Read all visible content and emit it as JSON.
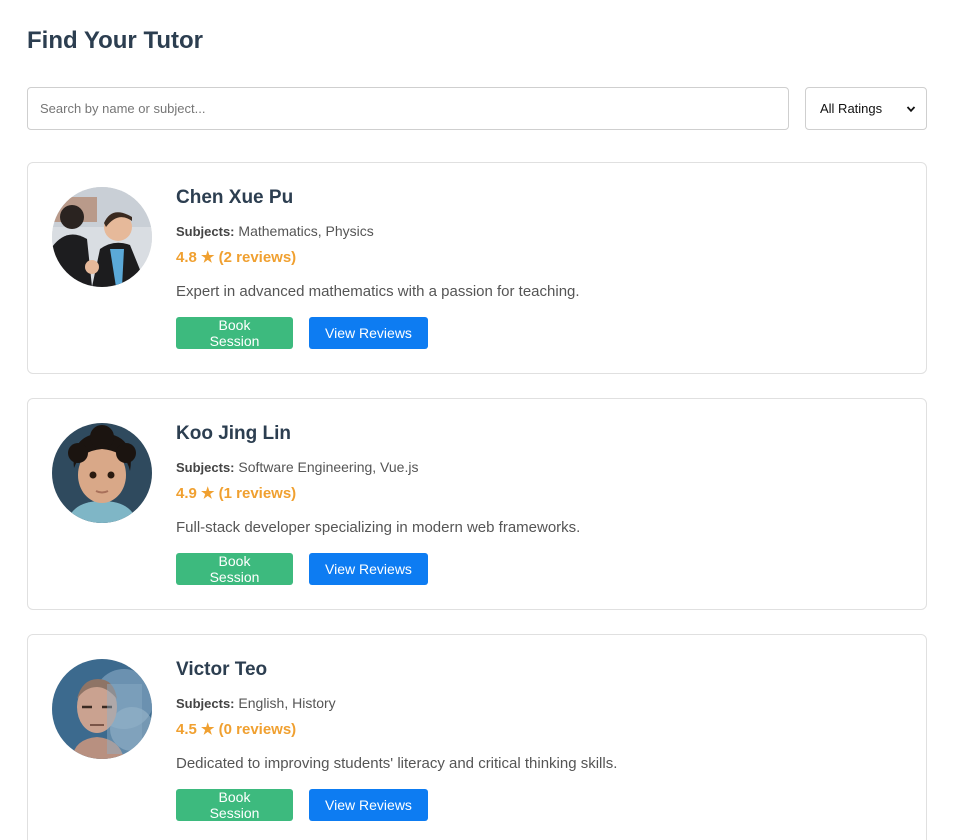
{
  "page_title": "Find Your Tutor",
  "search": {
    "placeholder": "Search by name or subject..."
  },
  "rating_filter": {
    "selected": "All Ratings",
    "icon": "chevron-down-icon"
  },
  "subjects_label": "Subjects:",
  "book_label": "Book Session",
  "reviews_label": "View Reviews",
  "colors": {
    "title": "#2c3e50",
    "rating": "#f0a030",
    "book_button": "#3dba7e",
    "reviews_button": "#0d7cf2"
  },
  "tutors": [
    {
      "name": "Chen Xue Pu",
      "subjects": "Mathematics, Physics",
      "rating": "4.8 ★ (2 reviews)",
      "bio": "Expert in advanced mathematics with a passion for teaching."
    },
    {
      "name": "Koo Jing Lin",
      "subjects": "Software Engineering, Vue.js",
      "rating": "4.9 ★ (1 reviews)",
      "bio": "Full-stack developer specializing in modern web frameworks."
    },
    {
      "name": "Victor Teo",
      "subjects": "English, History",
      "rating": "4.5 ★ (0 reviews)",
      "bio": "Dedicated to improving students' literacy and critical thinking skills."
    }
  ]
}
